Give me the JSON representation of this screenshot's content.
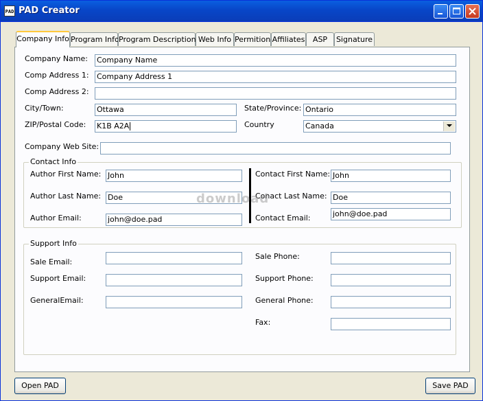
{
  "window": {
    "title": "PAD Creator",
    "icon_text": "PAD"
  },
  "tabs": [
    {
      "label": "Company Info",
      "active": true
    },
    {
      "label": "Program Info"
    },
    {
      "label": "Program Descriptions"
    },
    {
      "label": "Web Info"
    },
    {
      "label": "Permition"
    },
    {
      "label": "Affiliates"
    },
    {
      "label": "ASP"
    },
    {
      "label": "Signature"
    }
  ],
  "company": {
    "name_label": "Company Name:",
    "name_value": "Company Name",
    "addr1_label": "Comp Address 1:",
    "addr1_value": "Company Address 1",
    "addr2_label": "Comp Address 2:",
    "addr2_value": "",
    "city_label": "City/Town:",
    "city_value": "Ottawa",
    "state_label": "State/Province:",
    "state_value": "Ontario",
    "zip_label": "ZIP/Postal Code:",
    "zip_value": "K1B A2A",
    "country_label": "Country",
    "country_value": "Canada",
    "web_label": "Company Web Site:",
    "web_value": ""
  },
  "contact": {
    "group_title": "Contact Info",
    "author_first_label": "Author First Name:",
    "author_first_value": "John",
    "author_last_label": "Author Last Name:",
    "author_last_value": "Doe",
    "author_email_label": "Author Email:",
    "author_email_value": "john@doe.pad",
    "contact_first_label": "Contact First Name:",
    "contact_first_value": "John",
    "contact_last_label": "Conact Last Name:",
    "contact_last_value": "Doe",
    "contact_email_label": "Contact Email:",
    "contact_email_value": "john@doe.pad"
  },
  "support": {
    "group_title": "Support Info",
    "sale_email_label": "Sale Email:",
    "sale_email_value": "",
    "support_email_label": "Support Email:",
    "support_email_value": "",
    "general_email_label": "GeneralEmail:",
    "general_email_value": "",
    "sale_phone_label": "Sale Phone:",
    "sale_phone_value": "",
    "support_phone_label": "Support Phone:",
    "support_phone_value": "",
    "general_phone_label": "General Phone:",
    "general_phone_value": "",
    "fax_label": "Fax:",
    "fax_value": ""
  },
  "buttons": {
    "open": "Open PAD",
    "save": "Save PAD"
  },
  "watermark": "download"
}
